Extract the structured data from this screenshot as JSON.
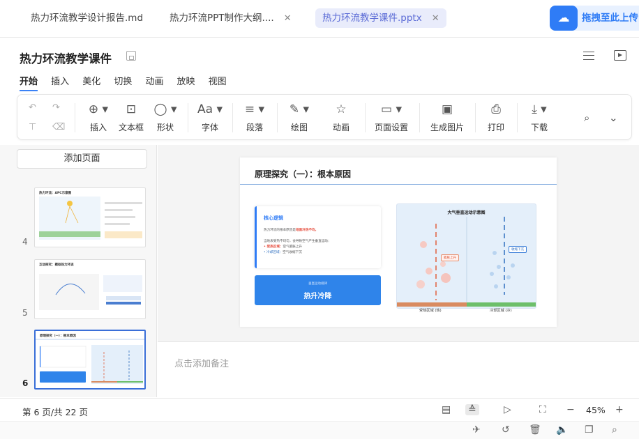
{
  "tabs": [
    {
      "label": "热力环流教学设计报告.md",
      "active": false,
      "closable": false
    },
    {
      "label": "热力环流PPT制作大纲....",
      "active": false,
      "closable": true
    },
    {
      "label": "热力环流教学课件.pptx",
      "active": true,
      "closable": true
    }
  ],
  "cloud_button": {
    "label": "拖拽至此上传",
    "icon": "cloud-icon"
  },
  "document": {
    "title": "热力环流教学课件"
  },
  "ribbon_tabs": [
    "开始",
    "插入",
    "美化",
    "切换",
    "动画",
    "放映",
    "视图"
  ],
  "active_ribbon_tab": "开始",
  "toolbar": {
    "insert": "插入",
    "textbox": "文本框",
    "shape": "形状",
    "font": "字体",
    "paragraph": "段落",
    "draw": "绘图",
    "animation": "动画",
    "page_setup": "页面设置",
    "gen_image": "生成图片",
    "print": "打印",
    "download": "下载"
  },
  "left_panel": {
    "add_page": "添加页面",
    "thumbnails": [
      {
        "number": "4",
        "title": "热力环流：APC示意图",
        "active": false
      },
      {
        "number": "5",
        "title": "互动探究：模拟热力环流",
        "active": false
      },
      {
        "number": "6",
        "title": "原理探究（一）：根本原因",
        "active": true
      }
    ]
  },
  "slide": {
    "title": "原理探究（一）：根本原因",
    "logic_card": {
      "heading": "核心逻辑",
      "line1_prefix": "热力环流的根本原因是",
      "line1_highlight": "地面冷热不均。",
      "line2": "当地表受热不均匀，会导致空气产生垂直运动：",
      "bullet1_label": "• 受热区域：",
      "bullet1_text": "空气膨胀上升",
      "bullet2_label": "• 冷却区域：",
      "bullet2_text": "空气收缩下沉"
    },
    "blue_card": {
      "small": "垂直运动规律",
      "big": "热升冷降"
    },
    "diagram": {
      "title": "大气垂直运动示意图",
      "rise_label": "膨胀上升",
      "sink_label": "收缩下沉",
      "left_ground": "受热区域 (热)",
      "right_ground": "冷却区域 (冷)"
    }
  },
  "notes_placeholder": "点击添加备注",
  "status": {
    "page_info": "第 6 页/共 22 页",
    "zoom": "45%"
  }
}
